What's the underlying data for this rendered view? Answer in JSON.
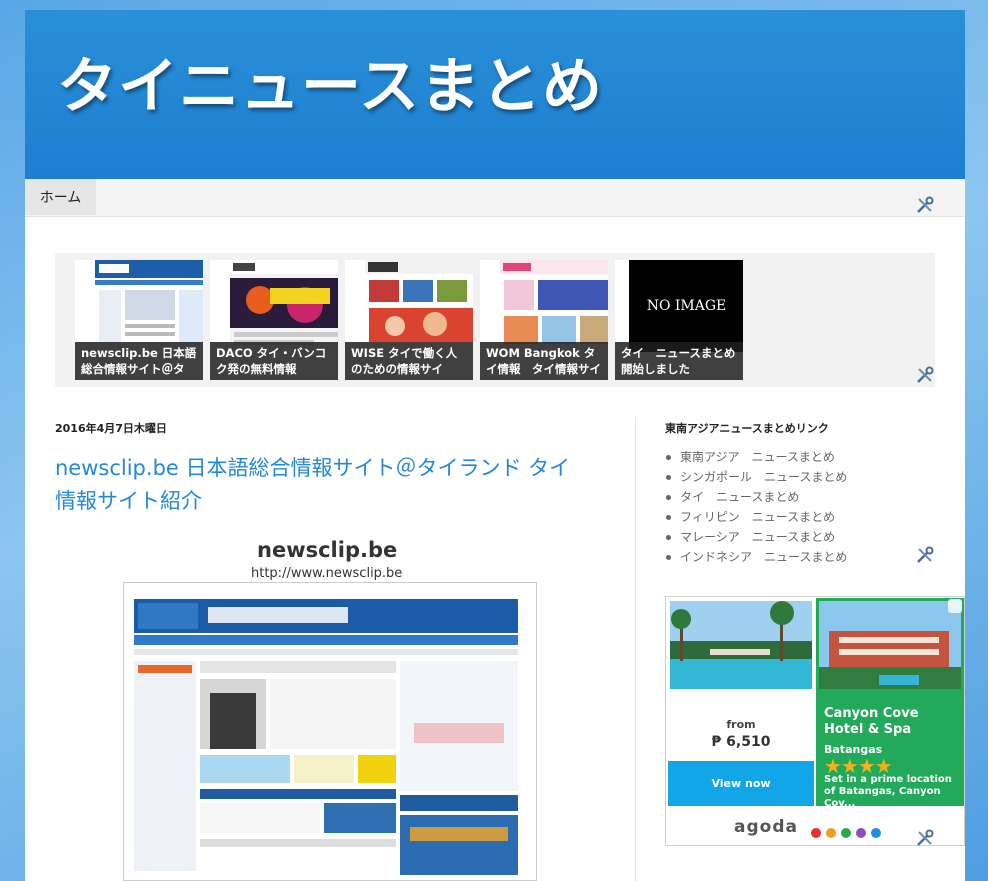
{
  "header": {
    "title": "タイニュースまとめ"
  },
  "nav": {
    "home_label": "ホーム"
  },
  "featured": [
    {
      "caption": "newsclip.be 日本語総合情報サイト＠タ"
    },
    {
      "caption": "DACO タイ・バンコク発の無料情報"
    },
    {
      "caption": "WISE タイで働く人のための情報サイ"
    },
    {
      "caption": "WOM Bangkok タイ情報　タイ情報サイ"
    },
    {
      "caption": "タイ　ニュースまとめ開始しました",
      "image_text": "NO IMAGE"
    }
  ],
  "post": {
    "date": "2016年4月7日木曜日",
    "title": "newsclip.be 日本語総合情報サイト＠タイランド タイ情報サイト紹介",
    "site_name": "newsclip.be",
    "site_url": "http://www.newsclip.be"
  },
  "sidebar": {
    "title": "東南アジアニュースまとめリンク",
    "links": [
      "東南アジア　ニュースまとめ",
      "シンガポール　ニュースまとめ",
      "タイ　ニュースまとめ",
      "フィリピン　ニュースまとめ",
      "マレーシア　ニュースまとめ",
      "インドネシア　ニュースまとめ"
    ]
  },
  "ad": {
    "from_label": "from",
    "price": "₱ 6,510",
    "view_label": "View now",
    "hotel_name": "Canyon Cove Hotel & Spa",
    "city": "Batangas",
    "rating_stars": 4,
    "description": "Set in a prime location of Batangas, Canyon Cov...",
    "brand": "agoda",
    "brand_dot_colors": [
      "#e8312f",
      "#f29b1f",
      "#2aa84a",
      "#8b4fbf",
      "#1f8fe0"
    ],
    "accent_green": "#23a95a",
    "accent_blue": "#12a5e8"
  },
  "colors": {
    "header_blue": "#1f84d3",
    "link_blue": "#2488d8"
  }
}
